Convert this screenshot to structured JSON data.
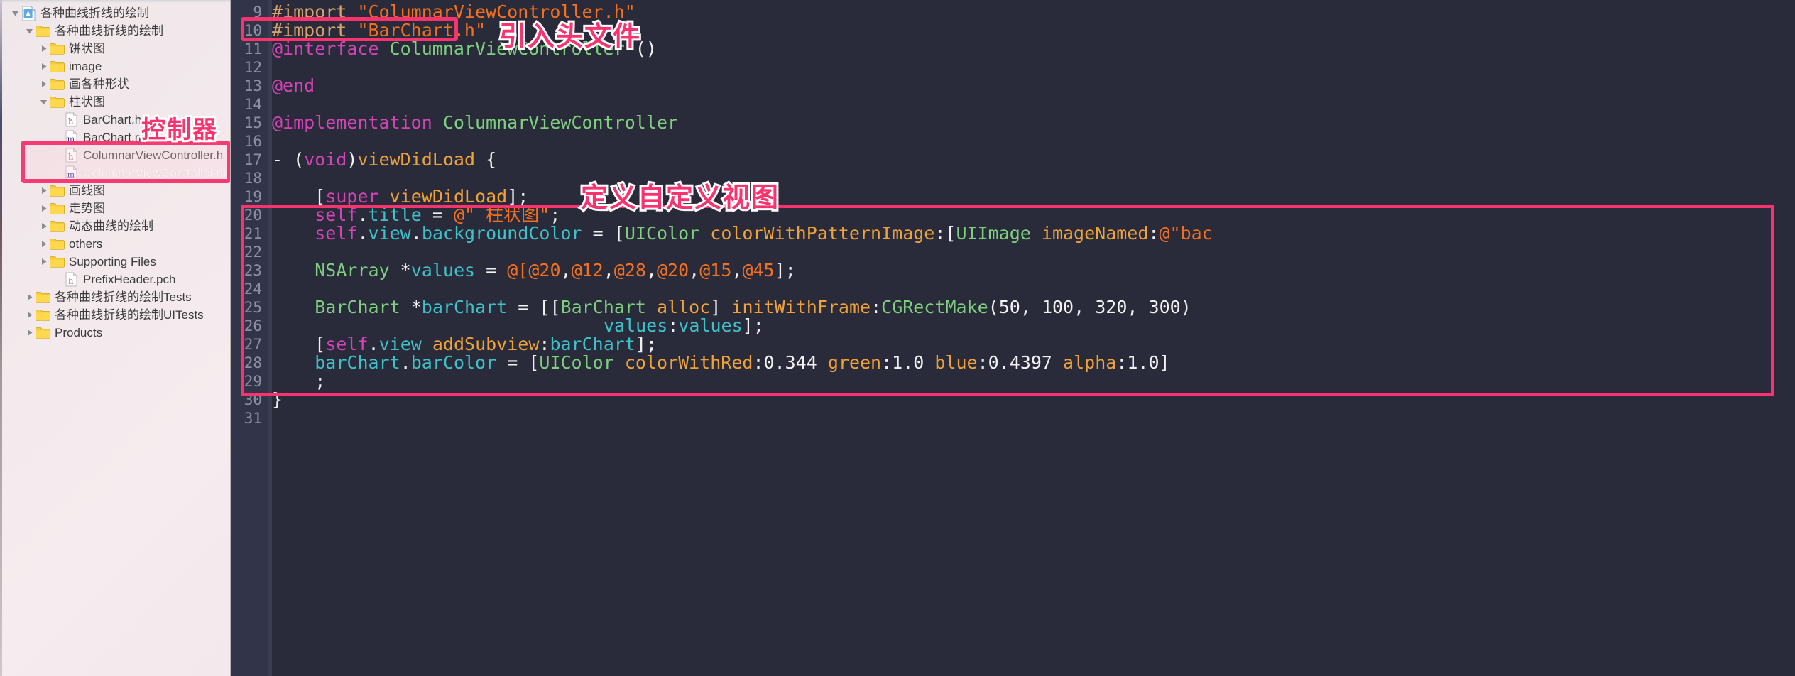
{
  "window": {
    "app": "Xcode",
    "theme_bg": "#292b3a",
    "gutter_bg": "#32344a",
    "accent_pink": "#f8336e"
  },
  "navigator": {
    "title": "Project Navigator",
    "items": [
      {
        "label": "各种曲线折线的绘制",
        "icon": "xcode-project-icon",
        "twisty": "down",
        "indent": 0
      },
      {
        "label": "各种曲线折线的绘制",
        "icon": "folder-icon",
        "twisty": "down",
        "indent": 1
      },
      {
        "label": "饼状图",
        "icon": "folder-icon",
        "twisty": "right",
        "indent": 2
      },
      {
        "label": "image",
        "icon": "folder-icon",
        "twisty": "right",
        "indent": 2
      },
      {
        "label": "画各种形状",
        "icon": "folder-icon",
        "twisty": "right",
        "indent": 2
      },
      {
        "label": "柱状图",
        "icon": "folder-icon",
        "twisty": "down",
        "indent": 2
      },
      {
        "label": "BarChart.h",
        "icon": "header-file-icon",
        "twisty": "none",
        "indent": 3
      },
      {
        "label": "BarChart.m",
        "icon": "source-file-icon",
        "twisty": "none",
        "indent": 3
      },
      {
        "label": "ColumnarViewController.h",
        "icon": "header-file-icon",
        "twisty": "none",
        "indent": 3
      },
      {
        "label": "ColumnarViewController.m",
        "icon": "source-file-icon",
        "twisty": "none",
        "indent": 3,
        "dim": true
      },
      {
        "label": "画线图",
        "icon": "folder-icon",
        "twisty": "right",
        "indent": 2
      },
      {
        "label": "走势图",
        "icon": "folder-icon",
        "twisty": "right",
        "indent": 2
      },
      {
        "label": "动态曲线的绘制",
        "icon": "folder-icon",
        "twisty": "right",
        "indent": 2
      },
      {
        "label": "others",
        "icon": "folder-icon",
        "twisty": "right",
        "indent": 2
      },
      {
        "label": "Supporting Files",
        "icon": "folder-icon",
        "twisty": "right",
        "indent": 2
      },
      {
        "label": "PrefixHeader.pch",
        "icon": "header-file-icon",
        "twisty": "none",
        "indent": 3
      },
      {
        "label": "各种曲线折线的绘制Tests",
        "icon": "folder-icon",
        "twisty": "right",
        "indent": 1
      },
      {
        "label": "各种曲线折线的绘制UITests",
        "icon": "folder-icon",
        "twisty": "right",
        "indent": 1
      },
      {
        "label": "Products",
        "icon": "folder-icon",
        "twisty": "right",
        "indent": 1
      }
    ]
  },
  "editor": {
    "first_line_number": 9,
    "lines": [
      {
        "n": 9,
        "text": "#import \"ColumnarViewController.h\""
      },
      {
        "n": 10,
        "text": "#import \"BarChart.h\""
      },
      {
        "n": 11,
        "text": "@interface ColumnarViewController ()"
      },
      {
        "n": 12,
        "text": ""
      },
      {
        "n": 13,
        "text": "@end"
      },
      {
        "n": 14,
        "text": ""
      },
      {
        "n": 15,
        "text": "@implementation ColumnarViewController"
      },
      {
        "n": 16,
        "text": ""
      },
      {
        "n": 17,
        "text": "- (void)viewDidLoad {"
      },
      {
        "n": 18,
        "text": ""
      },
      {
        "n": 19,
        "text": "    [super viewDidLoad];"
      },
      {
        "n": 20,
        "text": "    self.title = @\" 柱状图\";"
      },
      {
        "n": 21,
        "text": "    self.view.backgroundColor = [UIColor colorWithPatternImage:[UIImage imageNamed:@\"bac"
      },
      {
        "n": 22,
        "text": ""
      },
      {
        "n": 23,
        "text": "    NSArray *values = @[@20,@12,@28,@20,@15,@45];"
      },
      {
        "n": 24,
        "text": ""
      },
      {
        "n": 25,
        "text": "    BarChart *barChart = [[BarChart alloc] initWithFrame:CGRectMake(50, 100, 320, 300)"
      },
      {
        "n": 26,
        "text": "                               values:values];"
      },
      {
        "n": 27,
        "text": "    [self.view addSubview:barChart];"
      },
      {
        "n": 28,
        "text": "    barChart.barColor = [UIColor colorWithRed:0.344 green:1.0 blue:0.4397 alpha:1.0]"
      },
      {
        "n": 29,
        "text": "    ;"
      },
      {
        "n": 30,
        "text": "}"
      },
      {
        "n": 31,
        "text": ""
      }
    ]
  },
  "annotations": [
    {
      "name": "controller-annotation",
      "text": "控制器"
    },
    {
      "name": "import-header-annotation",
      "text": "引入头文件"
    },
    {
      "name": "custom-view-annotation",
      "text": "定义自定义视图"
    }
  ]
}
